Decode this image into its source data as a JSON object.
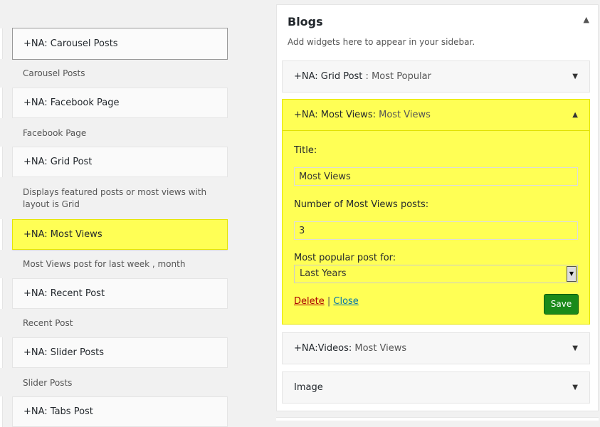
{
  "available_widgets": [
    {
      "name": "+NA: Carousel Posts",
      "description": "Carousel Posts"
    },
    {
      "name": "+NA: Facebook Page",
      "description": "Facebook Page"
    },
    {
      "name": "+NA: Grid Post",
      "description": "Displays featured posts or most views with layout is Grid"
    },
    {
      "name": "+NA: Most Views",
      "description": "Most Views post for last week , month"
    },
    {
      "name": "+NA: Recent Post",
      "description": "Recent Post"
    },
    {
      "name": "+NA: Slider Posts",
      "description": "Slider Posts"
    },
    {
      "name": "+NA: Tabs Post",
      "description": ""
    }
  ],
  "sidebar": {
    "title": "Blogs",
    "description": "Add widgets here to appear in your sidebar.",
    "widgets": [
      {
        "name": "+NA: Grid Post",
        "subtitle": " : Most Popular"
      },
      {
        "name": "+NA: Most Views:",
        "subtitle": " Most Views"
      },
      {
        "name": "+NA:Videos:",
        "subtitle": " Most Views"
      },
      {
        "name": "Image",
        "subtitle": ""
      }
    ],
    "open_widget": {
      "title_label": "Title:",
      "title_value": "Most Views",
      "count_label": "Number of Most Views posts:",
      "count_value": "3",
      "period_label": "Most popular post for:",
      "period_value": "Last Years",
      "delete_label": "Delete",
      "separator": " | ",
      "close_label": "Close",
      "save_label": "Save"
    }
  },
  "icons": {
    "collapse": "triangle-up",
    "expand": "triangle-down"
  },
  "colors": {
    "highlight": "#ffff55",
    "save_button": "#1a8a1a",
    "delete_link": "#aa0000",
    "close_link": "#0073aa"
  }
}
